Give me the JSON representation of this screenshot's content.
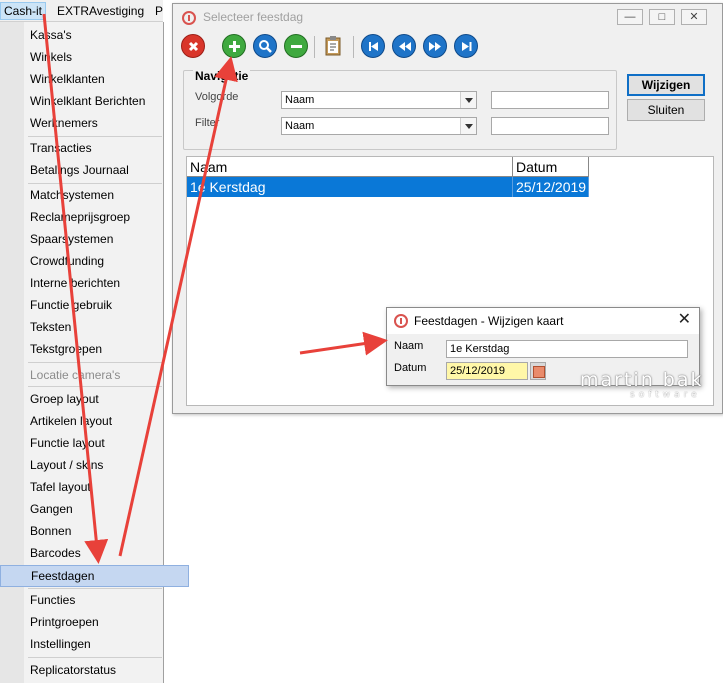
{
  "menubar": {
    "items": [
      "Cash-it",
      "EXTRAvestiging",
      "P"
    ]
  },
  "menu": {
    "items": [
      {
        "label": "Kassa's"
      },
      {
        "label": "Winkels"
      },
      {
        "label": "Winkelklanten"
      },
      {
        "label": "Winkelklant Berichten"
      },
      {
        "label": "Werknemers"
      },
      {
        "label": "Transacties"
      },
      {
        "label": "Betalings Journaal"
      },
      {
        "label": "Matchsystemen"
      },
      {
        "label": "Reclameprijsgroep"
      },
      {
        "label": "Spaarsystemen"
      },
      {
        "label": "Crowdfunding"
      },
      {
        "label": "Interne berichten"
      },
      {
        "label": "Functie gebruik"
      },
      {
        "label": "Teksten"
      },
      {
        "label": "Tekstgroepen"
      },
      {
        "label": "Locatie camera's",
        "disabled": true
      },
      {
        "label": "Groep layout"
      },
      {
        "label": "Artikelen layout"
      },
      {
        "label": "Functie layout"
      },
      {
        "label": "Layout / skins"
      },
      {
        "label": "Tafel layout"
      },
      {
        "label": "Gangen"
      },
      {
        "label": "Bonnen"
      },
      {
        "label": "Barcodes"
      },
      {
        "label": "Feestdagen",
        "selected": true
      },
      {
        "label": "Functies"
      },
      {
        "label": "Printgroepen"
      },
      {
        "label": "Instellingen"
      },
      {
        "label": "Replicatorstatus"
      }
    ]
  },
  "dialog": {
    "title": "Selecteer feestdag",
    "toolbar": [
      "delete-icon",
      "add-icon",
      "search-icon",
      "remove-icon",
      "clipboard-icon",
      "first-icon",
      "previous-icon",
      "next-icon",
      "last-icon"
    ],
    "nav_legend": "Navigatie",
    "volgorde_label": "Volgorde",
    "volgorde_value": "Naam",
    "filter_label": "Filter",
    "filter_value": "Naam",
    "wijzigen_label": "Wijzigen",
    "sluiten_label": "Sluiten",
    "grid": {
      "columns": [
        "Naam",
        "Datum"
      ],
      "rows": [
        [
          "1e Kerstdag",
          "25/12/2019"
        ]
      ]
    }
  },
  "subdialog": {
    "title": "Feestdagen - Wijzigen kaart",
    "naam_label": "Naam",
    "naam_value": "1e Kerstdag",
    "datum_label": "Datum",
    "datum_value": "25/12/2019"
  },
  "watermark": {
    "line1": "martin bak",
    "line2": "software"
  },
  "colors": {
    "selection": "#0a78d7",
    "arrow": "#e8413a",
    "menu_selected": "#c5d7f1",
    "date_field": "#fff7a8"
  }
}
